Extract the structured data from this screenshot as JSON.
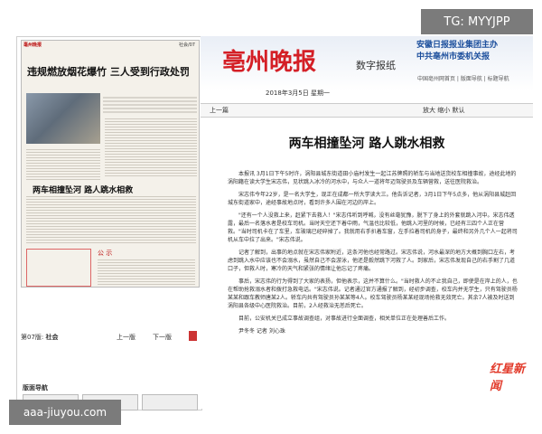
{
  "overlay": {
    "top_right": "TG: MYYJPP",
    "bottom_left": "aaa-jiuyou.com"
  },
  "left": {
    "thumb_masthead": "毫州晚报",
    "thumb_section": "社会/07",
    "thumb_headline": "违规燃放烟花爆竹 三人受到行政处罚",
    "thumb_subheadline": "两车相撞坠河 路人跳水相救",
    "thumb_notice": "公 示",
    "page_label_prefix": "第07版:",
    "page_label_name": "社会",
    "prev": "上一版",
    "next": "下一版",
    "nav_title": "版面导航"
  },
  "main": {
    "logo": "亳州晚报",
    "logo_sub": "数字报纸",
    "group_line1": "安徽日报报业集团主办",
    "group_line2": "中共亳州市委机关报",
    "top_links": "中国亳州网首页 | 版面导航 | 标题导航",
    "date": "2018年3月5日 星期一",
    "prev_article": "上一篇",
    "zoom": "放大  缩小  默认",
    "title": "两车相撞坠河  路人跳水相救",
    "paragraphs": [
      "本报讯 3月1日下午5时许，涡阳县城东街道田小庙村发生一起江苏牌照的轿车与当地送货校车相撞事故，途经此地的涡阳籍在读大学生宋志伟，见状跳入冰冷的河水中，与众人一道将年迈驾驶员及车辆营救，送往医院救治。",
      "宋志伟今年22岁，是一名大学生，现正在成都一所大学读大三。他告诉记者，3月1日下午5点多，他从涡阳县城赶回城东街道家中，途经事故地点时，看到许多人围在河边的岸上。",
      "\"还有一个人没救上来，赶紧下去救人！\"宋志伟听到呼喊，没有丝毫犹豫，脱下了身上的外套就跳入河中。宋志伟透露，最后一名落水者是校车司机。当时天空还下着中雨，气温也比较低，他跳入河里的时候，已经有三四个人正在营救。\"当时司机卡在了车里，车玻璃已经碎掉了。我就用右手扒着车窗，左手拉着司机的身子，最终和另外几个人一起将司机从车中拉了出来。\"宋志伟说。",
      "记者了解到，出事的地点就在宋志伟家附近，这条河他也经常路过。宋志伟说，河水最深的地方大概到胸口左右，考虑到跳入水中应该也不会溺水，虽然自己不会游泳，他还是毅然跳下河救了人。到家后，宋志伟发现自己的右手割了几道口子，但救人时，寒冷的天气和紧张的情绪让他忘记了疼痛。",
      "事后，宋志伟的行为得到了大家的表扬，但他表示，这并不算什么。\"当时救人的不止我自己，即使是在岸上的人，也在帮助抢救溺水者和拨打急救电话。\"宋志伟说。记者通过官方通报了解到，经初步调查，校车内并无学生，只有驾驶员杨某某和跟车教师唐某2人。轿车内共有驾驶员孙某某等4人。校车驾驶员杨某某经现场抢救无效死亡。其余7人被及时送到涡阳县各级中心医院救治。目前，2人经救治无恙后死亡。",
      "目前，公安机关已成立事故调查组，对事故进行全面调查，相关单位正在处理善后工作。"
    ],
    "reporter": "尹冬冬 记者 刘心珠",
    "stamp": "红星新闻"
  }
}
